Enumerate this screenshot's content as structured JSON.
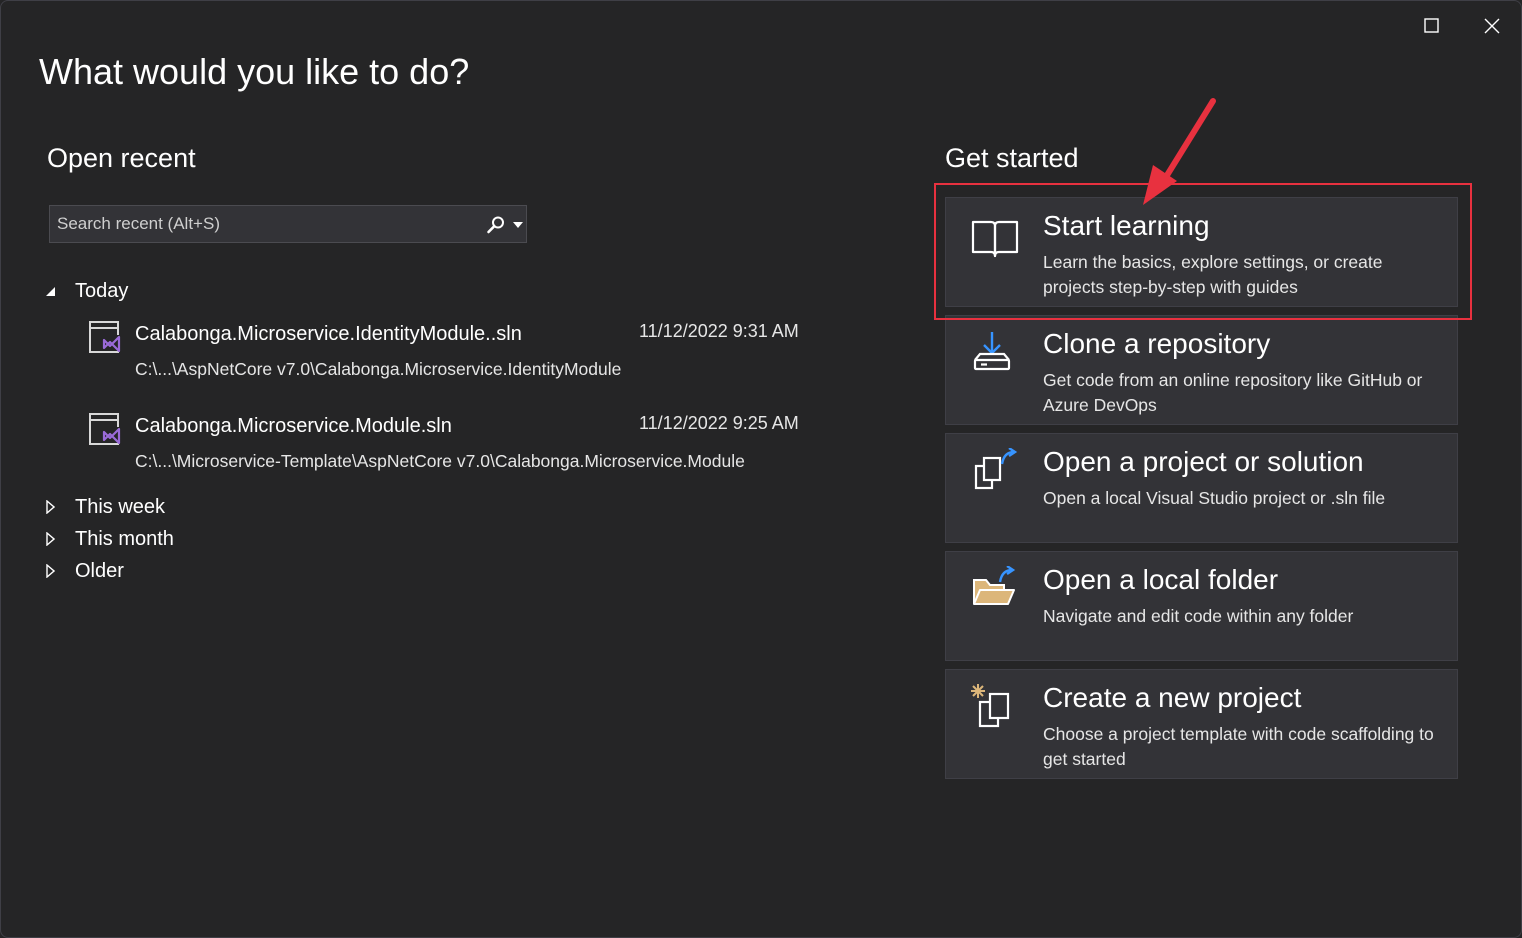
{
  "window": {
    "heading": "What would you like to do?"
  },
  "open_recent": {
    "title": "Open recent",
    "search": {
      "placeholder": "Search recent (Alt+S)",
      "value": ""
    },
    "groups": {
      "today": "Today",
      "this_week": "This week",
      "this_month": "This month",
      "older": "Older"
    },
    "items": [
      {
        "name": "Calabonga.Microservice.IdentityModule..sln",
        "date": "11/12/2022 9:31 AM",
        "path": "C:\\...\\AspNetCore v7.0\\Calabonga.Microservice.IdentityModule"
      },
      {
        "name": "Calabonga.Microservice.Module.sln",
        "date": "11/12/2022 9:25 AM",
        "path": "C:\\...\\Microservice-Template\\AspNetCore v7.0\\Calabonga.Microservice.Module"
      }
    ]
  },
  "get_started": {
    "title": "Get started",
    "cards": [
      {
        "title": "Start learning",
        "desc": "Learn the basics, explore settings, or create projects step-by-step with guides",
        "icon": "book-icon"
      },
      {
        "title": "Clone a repository",
        "desc": "Get code from an online repository like GitHub or Azure DevOps",
        "icon": "clone-icon"
      },
      {
        "title": "Open a project or solution",
        "desc": "Open a local Visual Studio project or .sln file",
        "icon": "open-project-icon"
      },
      {
        "title": "Open a local folder",
        "desc": "Navigate and edit code within any folder",
        "icon": "folder-icon"
      },
      {
        "title": "Create a new project",
        "desc": "Choose a project template with code scaffolding to get started",
        "icon": "new-project-icon"
      }
    ]
  },
  "colors": {
    "background": "#252526",
    "card": "#333337",
    "highlight": "#e8313f",
    "vs_purple": "#9a6bd8",
    "accent_blue": "#3794ff",
    "folder_yellow": "#dcb67a"
  }
}
